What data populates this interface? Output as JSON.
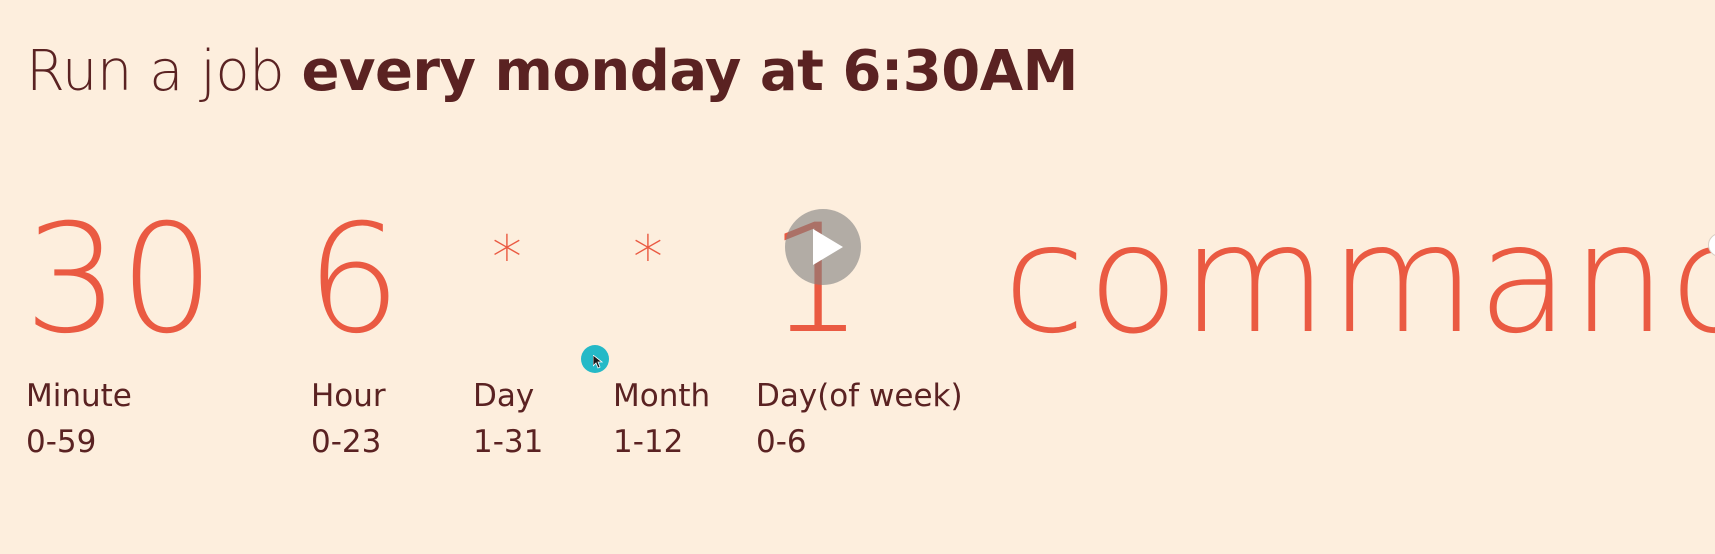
{
  "title": {
    "prefix": "Run a job ",
    "emphasis": "every monday at 6:30AM"
  },
  "cron": {
    "fields": [
      {
        "value": "30",
        "label": "Minute",
        "range": "0-59"
      },
      {
        "value": "6",
        "label": "Hour",
        "range": "0-23"
      },
      {
        "value": "*",
        "label": "Day",
        "range": "1-31"
      },
      {
        "value": "*",
        "label": "Month",
        "range": "1-12"
      },
      {
        "value": "1",
        "label": "Day(of week)",
        "range": "0-6"
      }
    ],
    "command": "command"
  },
  "player": {
    "play_icon": "play-icon",
    "cursor_icon": "pointer-cursor-icon"
  },
  "colors": {
    "background": "#fdeedd",
    "accent": "#ea5a42",
    "text": "#5a2222",
    "cursor_highlight": "#25b9c7"
  }
}
